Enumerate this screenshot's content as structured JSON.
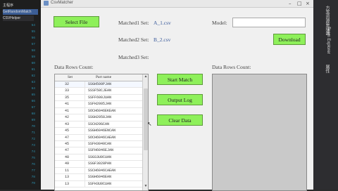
{
  "ide": {
    "tabs": [
      "主程序",
      "GetRandomMatch",
      "CSVHelper"
    ],
    "line_numbers": [
      "54",
      "55",
      "56",
      "57",
      "58",
      "59",
      "60",
      "61",
      "62",
      "63",
      "64",
      "65",
      "66",
      "67",
      "68",
      "69",
      "70",
      "71",
      "72",
      "73",
      "74",
      "75",
      "76",
      "77",
      "78",
      "79"
    ],
    "right_tabs": [
      "方案资源管理器",
      "Team Explorer",
      "属性"
    ]
  },
  "window": {
    "title": "CsvMatcher",
    "controls": {
      "minimize": "–",
      "maximize": "□",
      "close": "×"
    }
  },
  "buttons": {
    "select_file": "Select File",
    "download": "Download",
    "start_match": "Start Match",
    "output_log": "Output Log",
    "clear_data": "Clear Data"
  },
  "labels": {
    "matched1": "Matched1 Set:",
    "matched2": "Matched2 Set:",
    "matched3": "Matched3 Set:",
    "model": "Model:",
    "data_rows_left": "Data Rows Count:",
    "data_rows_right": "Data Rows Count:"
  },
  "values": {
    "matched1": "A_1.csv",
    "matched2": "B_2.csv",
    "matched3": "",
    "model": ""
  },
  "grid": {
    "columns": [
      "Set",
      "Part name"
    ],
    "rows": [
      [
        "32",
        "SSGH500PJAN"
      ],
      [
        "33",
        "SSSF58CJEAN"
      ],
      [
        "35",
        "SSFF600JUAN"
      ],
      [
        "41",
        "SSFH2005JAN"
      ],
      [
        "41",
        "SOCH6046EKEAN"
      ],
      [
        "42",
        "SSGH2058JAN"
      ],
      [
        "43",
        "SSCH20GCAN"
      ],
      [
        "45",
        "SSGH6046ENCAN"
      ],
      [
        "47",
        "SOCH6046CAEAN"
      ],
      [
        "45",
        "SSFH3040CAN"
      ],
      [
        "47",
        "SSFH6046EJAN"
      ],
      [
        "48",
        "SSGS3U0CUAN"
      ],
      [
        "49",
        "SSGF3028PAN"
      ],
      [
        "11",
        "SSCH6046CAEAN"
      ],
      [
        "13",
        "SSGH6046EAN"
      ],
      [
        "13",
        "SSFH3U0CUAN"
      ]
    ]
  }
}
